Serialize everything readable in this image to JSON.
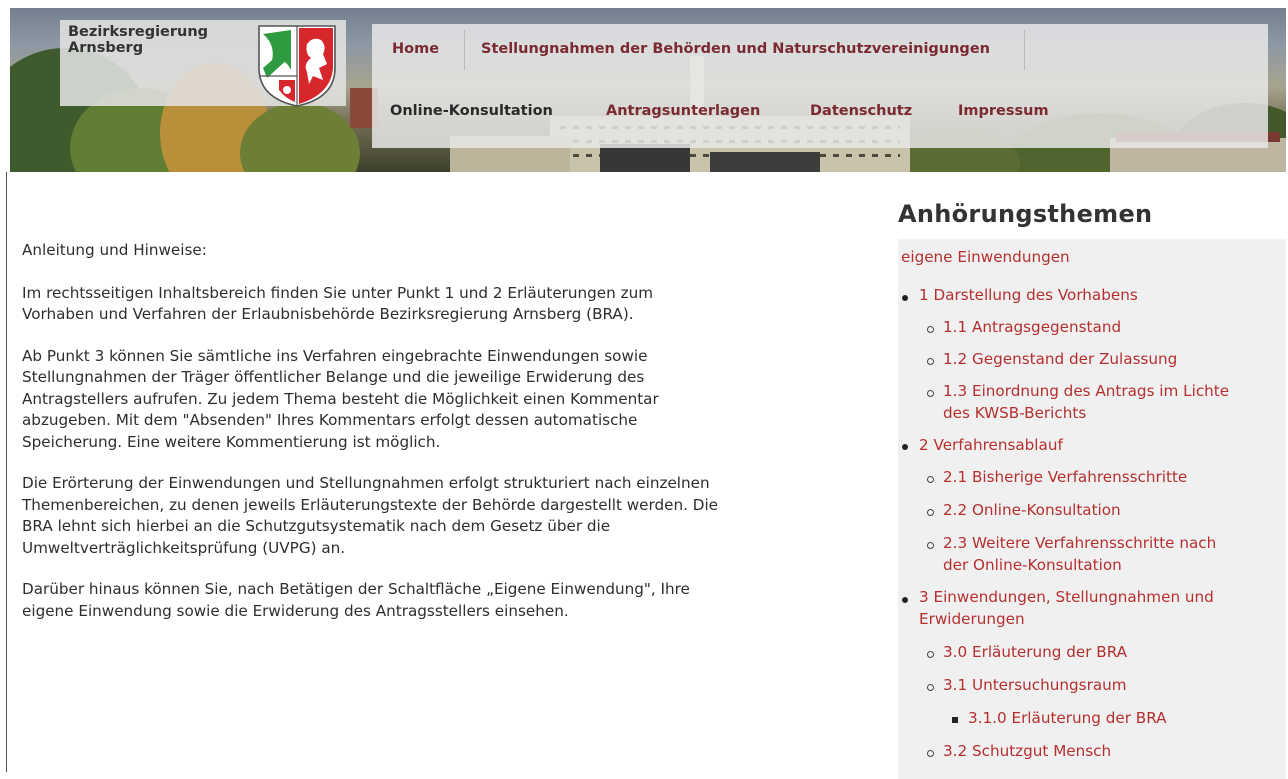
{
  "header": {
    "org_name": "Bezirksregierung\nArnsberg",
    "coat_of_arms": "coat-of-arms-nrw",
    "nav_row1": [
      "Home",
      "Stellungnahmen der Behörden und Naturschutzvereinigungen"
    ],
    "nav_row2": [
      "Online-Konsultation",
      "Antragsunterlagen",
      "Datenschutz",
      "Impressum"
    ]
  },
  "main": {
    "heading": "Anleitung und Hinweise:",
    "paragraphs": [
      "Im rechtsseitigen Inhaltsbereich finden Sie unter Punkt 1 und 2 Erläuterungen zum\nVorhaben und Verfahren der Erlaubnisbehörde Bezirksregierung Arnsberg (BRA).",
      "Ab Punkt 3 können Sie sämtliche ins Verfahren eingebrachte Einwendungen sowie\nStellungnahmen der Träger öffentlicher Belange und die jeweilige Erwiderung des\nAntragstellers aufrufen. Zu jedem Thema besteht die Möglichkeit einen Kommentar\nabzugeben. Mit dem \"Absenden\" Ihres Kommentars erfolgt dessen automatische\nSpeicherung. Eine weitere Kommentierung ist möglich.",
      "Die Erörterung der Einwendungen und Stellungnahmen erfolgt strukturiert nach einzelnen\nThemenbereichen, zu denen jeweils Erläuterungstexte der Behörde dargestellt werden. Die\nBRA lehnt sich hierbei an die Schutzgutsystematik nach dem Gesetz über die\nUmweltverträglichkeitsprüfung (UVPG) an.",
      "Darüber hinaus können Sie, nach Betätigen der Schaltfläche „Eigene Einwendung\", Ihre\neigene Einwendung sowie die Erwiderung des Antragsstellers einsehen."
    ]
  },
  "sidebar": {
    "title": "Anhörungsthemen",
    "top_link": "eigene Einwendungen",
    "items": [
      {
        "label": "1 Darstellung des Vorhabens",
        "level": 1
      },
      {
        "label": "1.1 Antragsgegenstand",
        "level": 2
      },
      {
        "label": "1.2 Gegenstand der Zulassung",
        "level": 2
      },
      {
        "label": "1.3 Einordnung des Antrags im Lichte\ndes KWSB-Berichts",
        "level": 2
      },
      {
        "label": "2 Verfahrensablauf",
        "level": 1
      },
      {
        "label": "2.1 Bisherige Verfahrensschritte",
        "level": 2
      },
      {
        "label": "2.2 Online-Konsultation",
        "level": 2
      },
      {
        "label": "2.3 Weitere Verfahrensschritte nach\nder Online-Konsultation",
        "level": 2
      },
      {
        "label": "3 Einwendungen, Stellungnahmen und\nErwiderungen",
        "level": 1
      },
      {
        "label": "3.0 Erläuterung der BRA",
        "level": 2
      },
      {
        "label": "3.1 Untersuchungsraum",
        "level": 2
      },
      {
        "label": "3.1.0 Erläuterung der BRA",
        "level": 3
      },
      {
        "label": "3.2 Schutzgut Mensch",
        "level": 2
      }
    ]
  },
  "colors": {
    "link_red": "#b4302f",
    "nav_text": "#7a2a30",
    "text": "#2e2e2e",
    "panel_bg": "#f0f0f0"
  }
}
